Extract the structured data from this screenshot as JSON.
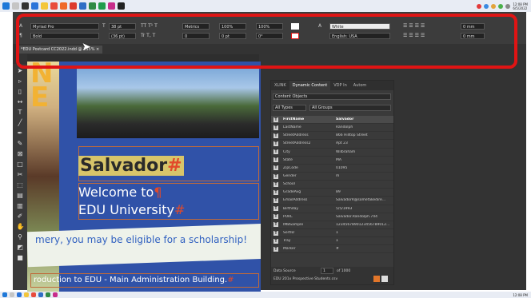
{
  "window": {
    "document_tab": "*EDU Postcard CC2022.indd @ 155%"
  },
  "control_panel": {
    "font_family": "Myriad Pro",
    "font_style": "Bold",
    "font_size": "38 pt",
    "leading": "(36 pt)",
    "kerning": "Metrics",
    "horizontal_scale": "100%",
    "vertical_scale": "100%",
    "tracking": "0",
    "baseline_shift": "0 pt",
    "skew": "0°",
    "character_style": "[None]",
    "fill_color": "White",
    "language": "English: USA",
    "indent_left": "0 mm",
    "indent_right": "0 mm"
  },
  "document": {
    "side_letters": [
      "N",
      "E"
    ],
    "name": "Salvador",
    "welcome_line1": "Welcome to",
    "welcome_line2": "EDU University",
    "banner": "mery, you may be eligible for a scholarship!",
    "bottom_line": "roduction to EDU - Main Administration Building."
  },
  "panel": {
    "tabs": [
      "XLINK",
      "Dynamic Content",
      "VDP In",
      "Autom"
    ],
    "content_select": "Content Objects",
    "type_filter": "All Types",
    "group_filter": "All Groups",
    "fields": [
      {
        "name": "FirstName",
        "value": "Salvador"
      },
      {
        "name": "LastName",
        "value": "Randolph"
      },
      {
        "name": "StreetAddress",
        "value": "866 Hilltop Street"
      },
      {
        "name": "StreetAddress2",
        "value": "Apt 23"
      },
      {
        "name": "City",
        "value": "Wilbraham"
      },
      {
        "name": "State",
        "value": "MA"
      },
      {
        "name": "ZipCode",
        "value": "01095"
      },
      {
        "name": "Gender",
        "value": "m"
      },
      {
        "name": "School",
        "value": ""
      },
      {
        "name": "GradeAvg",
        "value": "89"
      },
      {
        "name": "EmailAddress",
        "value": "SalvadorR@somefakedire..."
      },
      {
        "name": "Birthday",
        "value": "5/5/1993"
      },
      {
        "name": "PURL",
        "value": "Salvador.Randolph.744"
      },
      {
        "name": "IMBSample",
        "value": "1234567890123456789012..."
      },
      {
        "name": "SortID",
        "value": "1"
      },
      {
        "name": "Tray",
        "value": "1"
      },
      {
        "name": "Marker",
        "value": "#"
      }
    ],
    "data_source_label": "Data Source",
    "record_current": "1",
    "record_total": "of 1000",
    "data_file": "EDU 201x Prospective Students.csv"
  },
  "taskbar": {
    "time_top": "12:08 PM",
    "date_top": "6/5/2022",
    "time_bottom": "12:08 PM"
  },
  "colors": {
    "annotation_red": "#e01414",
    "accent_orange": "#f2b233"
  }
}
